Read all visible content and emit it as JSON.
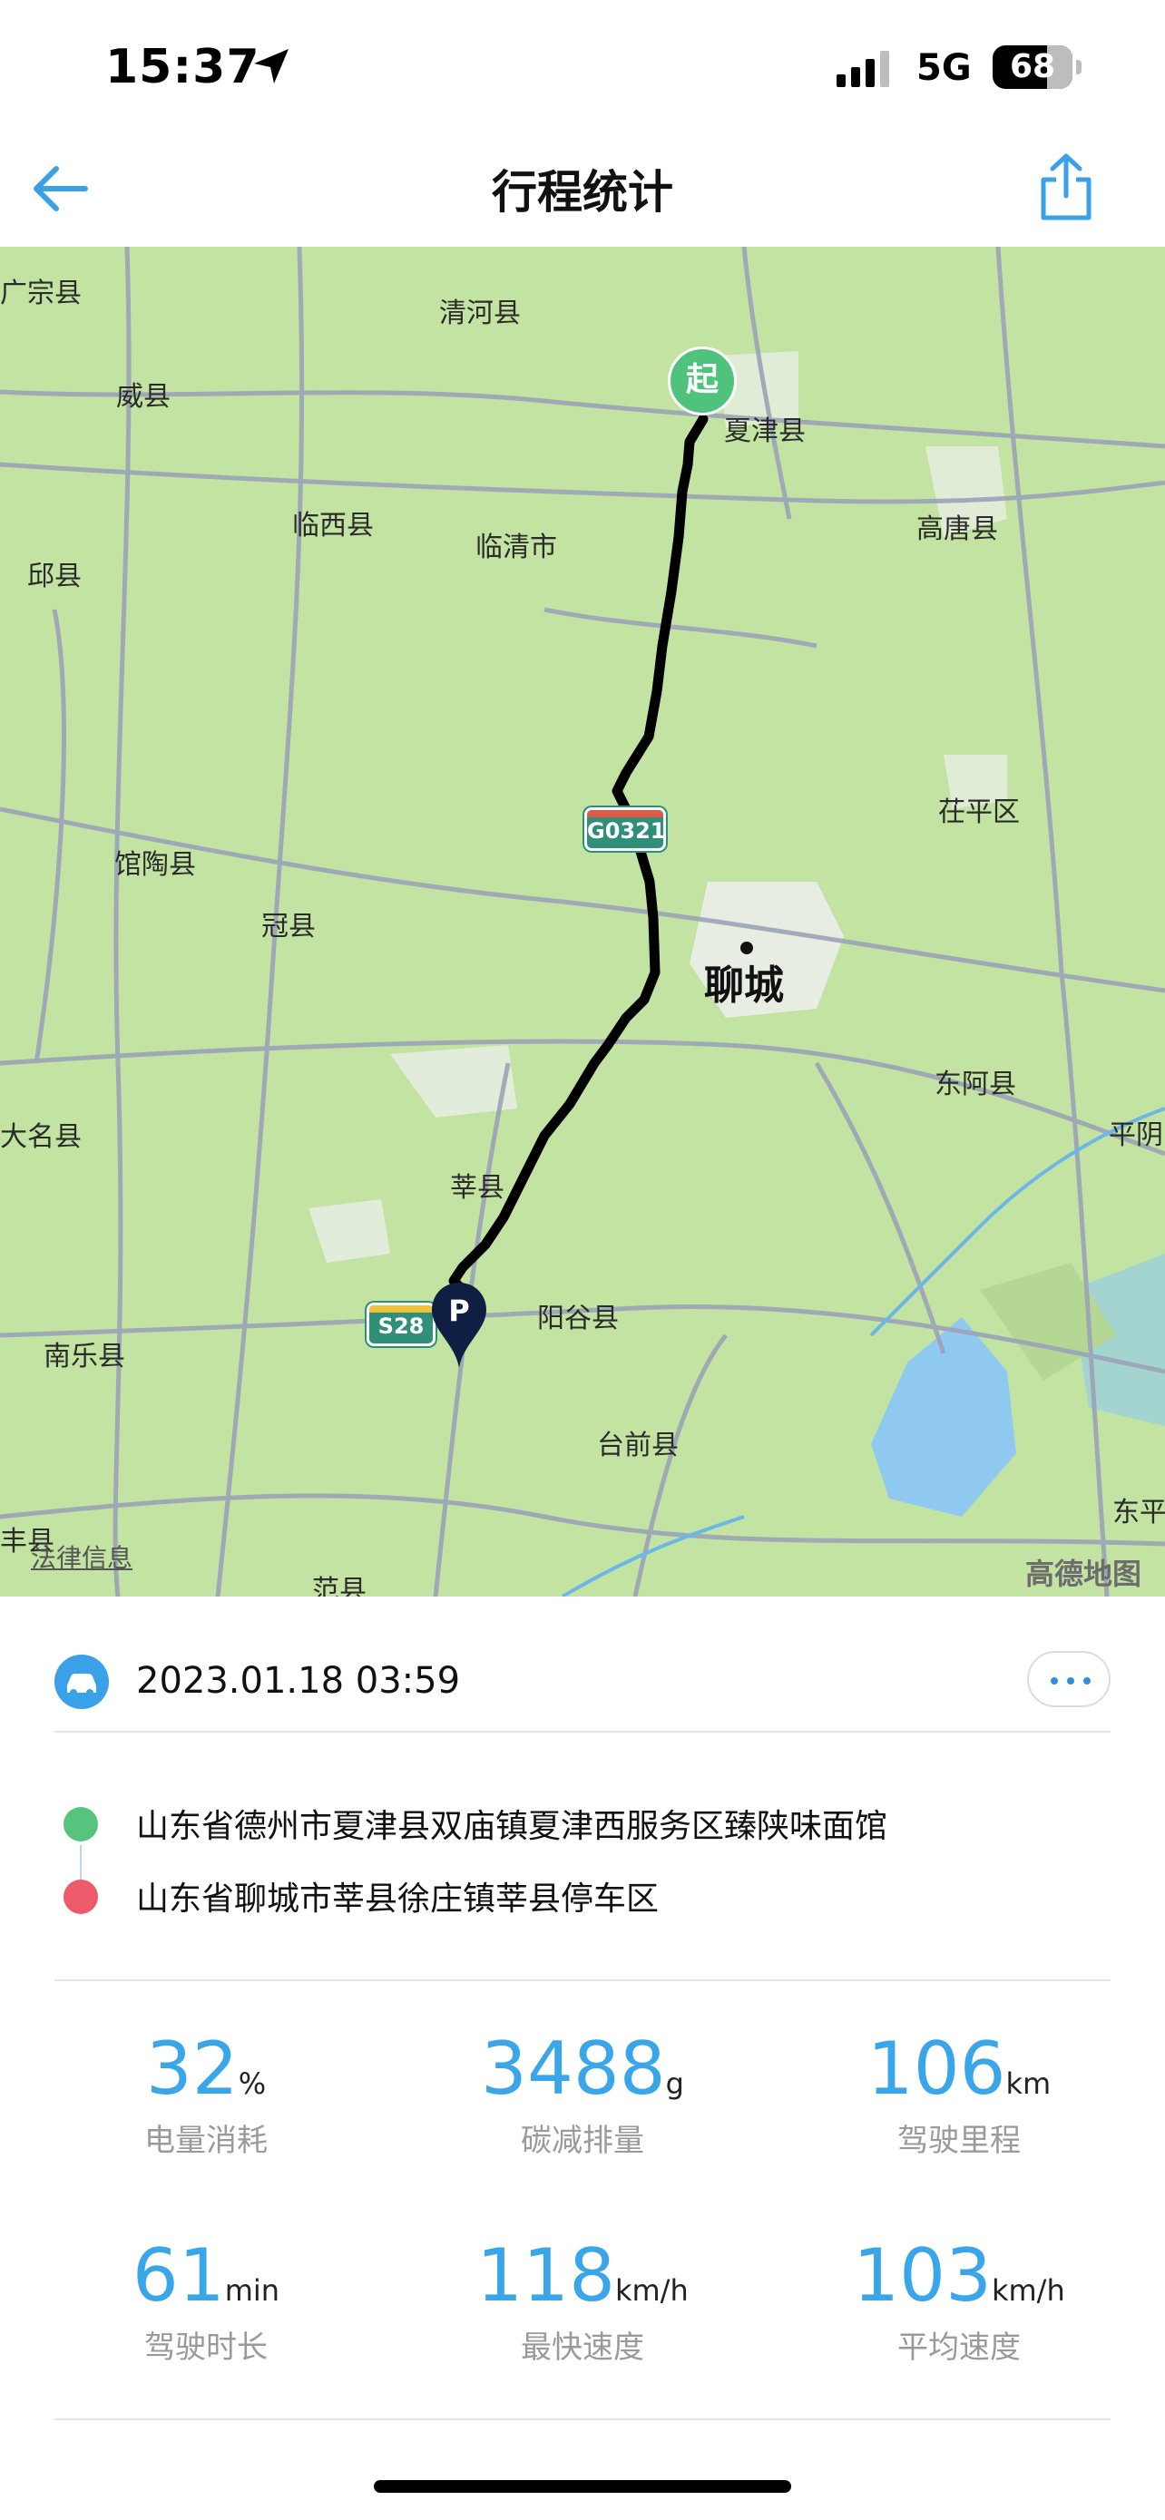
{
  "status_bar": {
    "time": "15:37",
    "network": "5G",
    "battery": "68"
  },
  "nav": {
    "title": "行程统计"
  },
  "map": {
    "labels": {
      "xiajin": "夏津县",
      "qinghe": "清河县",
      "weixian": "威县",
      "guangzong": "广宗县",
      "linxi": "临西县",
      "linqing": "临清市",
      "gaotang": "高唐县",
      "qiuxian": "邱县",
      "chiping": "茌平区",
      "guantao": "馆陶县",
      "guanxian": "冠县",
      "liaocheng": "聊城",
      "donge": "东阿县",
      "daming": "大名县",
      "shenxian": "莘县",
      "pingyin": "平阴",
      "yanggu": "阳谷县",
      "nanle": "南乐县",
      "taiqian": "台前县",
      "dongping": "东平",
      "fanxian": "范县",
      "qingfeng": "丰县"
    },
    "shields": {
      "g0321": "G0321",
      "s28": "S28"
    },
    "start_marker": "起",
    "park_marker": "P",
    "law_link": "法律信息",
    "brand": "高德地图"
  },
  "trip": {
    "datetime": "2023.01.18 03:59",
    "start_address": "山东省德州市夏津县双庙镇夏津西服务区臻陕味面馆",
    "end_address": "山东省聊城市莘县徐庄镇莘县停车区"
  },
  "stats": [
    {
      "value": "32",
      "unit": "%",
      "label": "电量消耗"
    },
    {
      "value": "3488",
      "unit": "g",
      "label": "碳减排量"
    },
    {
      "value": "106",
      "unit": "km",
      "label": "驾驶里程"
    },
    {
      "value": "61",
      "unit": "min",
      "label": "驾驶时长"
    },
    {
      "value": "118",
      "unit": "km/h",
      "label": "最快速度"
    },
    {
      "value": "103",
      "unit": "km/h",
      "label": "平均速度"
    }
  ],
  "colors": {
    "accent": "#3aa6ea",
    "start_dot": "#4fc37c",
    "end_dot": "#ec5a6b",
    "route": "#000000"
  }
}
